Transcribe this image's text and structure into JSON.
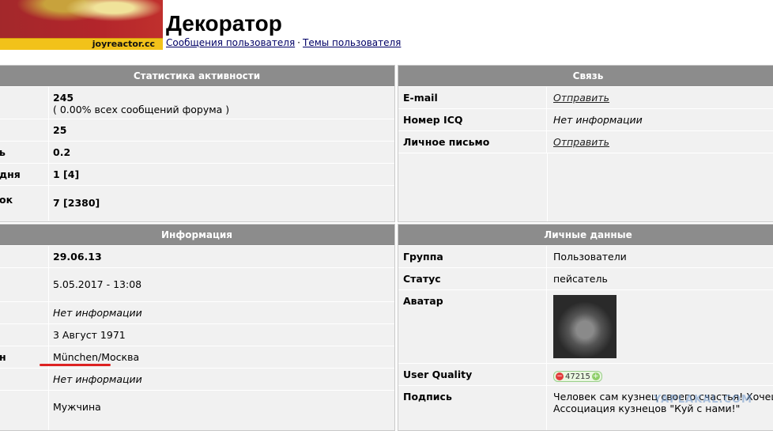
{
  "header": {
    "logo_text": "joyreactor.cc",
    "title": "Декоратор",
    "links": [
      "Сообщения пользователя",
      "Темы пользователя"
    ],
    "separator": "·"
  },
  "stats": {
    "title": "Статистика активности",
    "rows": [
      {
        "label": "",
        "value": "245",
        "sub": "( 0.00% всех сообщений форума )"
      },
      {
        "label": "",
        "value": "25"
      },
      {
        "label": "ь",
        "value": "0.2"
      },
      {
        "label": "дня",
        "value": "1 [4]"
      },
      {
        "label": "ок",
        "value": "7 [2380]"
      }
    ]
  },
  "contact": {
    "title": "Связь",
    "rows": [
      {
        "label": "E-mail",
        "value": "Отправить"
      },
      {
        "label": "Номер ICQ",
        "value": "Нет информации"
      },
      {
        "label": "Личное письмо",
        "value": "Отправить"
      }
    ]
  },
  "info": {
    "title": "Информация",
    "rows": [
      {
        "label": "",
        "value": "29.06.13"
      },
      {
        "label": "",
        "value": "5.05.2017 - 13:08"
      },
      {
        "label": "",
        "value": "Нет информации"
      },
      {
        "label": "",
        "value": "3 Август 1971"
      },
      {
        "label": "н",
        "value": "München/Москва"
      },
      {
        "label": "",
        "value": "Нет информации"
      },
      {
        "label": "",
        "value": "Мужчина"
      }
    ]
  },
  "personal": {
    "title": "Личные данные",
    "group_label": "Группа",
    "group_value": "Пользователи",
    "status_label": "Статус",
    "status_value": "пейсатель",
    "avatar_label": "Аватар",
    "quality_label": "User Quality",
    "quality_value": "47215",
    "signature_label": "Подпись",
    "signature_line1": "Человек сам кузнец своего счастья! Хочешь с",
    "signature_line2": "Ассоциация кузнецов \"Куй с нами!\""
  },
  "watermark": "YAPLAKAL.COM"
}
